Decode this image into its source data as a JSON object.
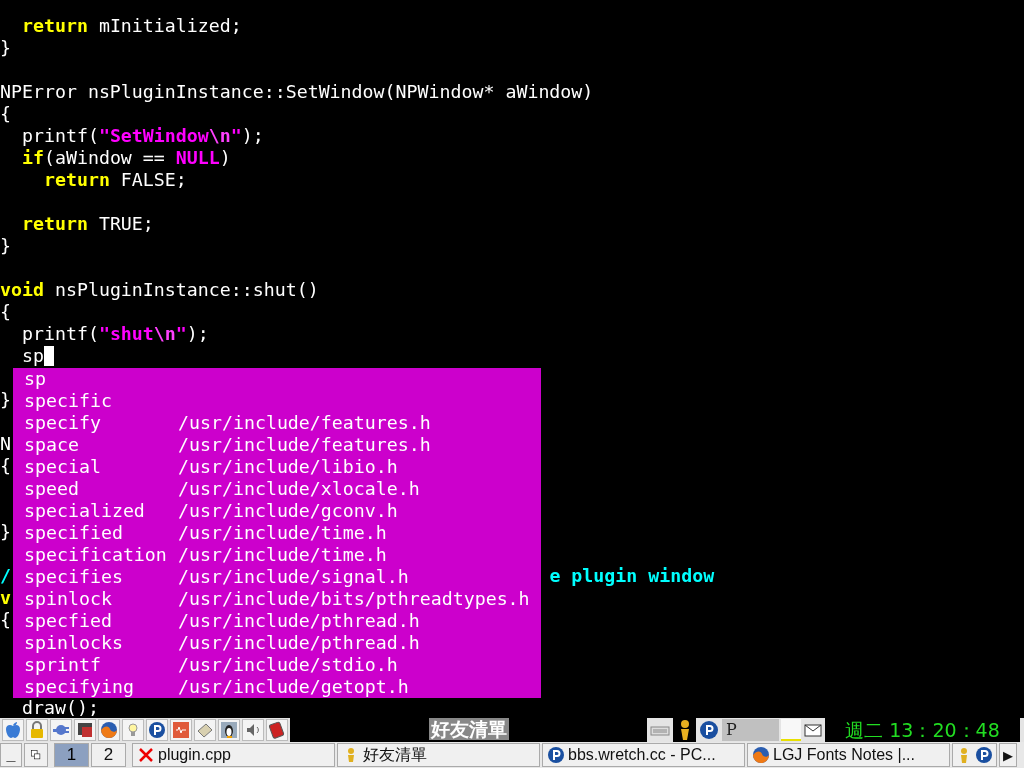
{
  "editor": {
    "lines": [
      {
        "cursor": false,
        "tokens": [
          {
            "text": "  return",
            "kind": "keyword"
          },
          {
            "text": " mInitialized;",
            "kind": "plain"
          }
        ]
      },
      {
        "cursor": false,
        "tokens": [
          {
            "text": "}",
            "kind": "plain"
          }
        ]
      },
      {
        "cursor": false
      },
      {
        "cursor": false,
        "tokens": [
          {
            "text": "NPError nsPluginInstance::SetWindow(NPWindow* aWindow)",
            "kind": "plain"
          }
        ]
      },
      {
        "cursor": false,
        "tokens": [
          {
            "text": "{",
            "kind": "plain"
          }
        ]
      },
      {
        "cursor": false,
        "tokens": [
          {
            "text": "  printf(",
            "kind": "plain"
          },
          {
            "text": "\"SetWindow",
            "kind": "string"
          },
          {
            "text": "\\n",
            "kind": "escape"
          },
          {
            "text": "\"",
            "kind": "string"
          },
          {
            "text": ");",
            "kind": "plain"
          }
        ]
      },
      {
        "cursor": false,
        "tokens": [
          {
            "text": "  if",
            "kind": "keyword"
          },
          {
            "text": "(aWindow == ",
            "kind": "plain"
          },
          {
            "text": "NULL",
            "kind": "constant"
          },
          {
            "text": ")",
            "kind": "plain"
          }
        ]
      },
      {
        "cursor": false,
        "tokens": [
          {
            "text": "    return",
            "kind": "keyword"
          },
          {
            "text": " FALSE;",
            "kind": "plain"
          }
        ]
      },
      {
        "cursor": false
      },
      {
        "cursor": false,
        "tokens": [
          {
            "text": "  return",
            "kind": "keyword"
          },
          {
            "text": " TRUE;",
            "kind": "plain"
          }
        ]
      },
      {
        "cursor": false,
        "tokens": [
          {
            "text": "}",
            "kind": "plain"
          }
        ]
      },
      {
        "cursor": false
      },
      {
        "cursor": false,
        "tokens": [
          {
            "text": "void",
            "kind": "keyword"
          },
          {
            "text": " nsPluginInstance::shut()",
            "kind": "plain"
          }
        ]
      },
      {
        "cursor": false,
        "tokens": [
          {
            "text": "{",
            "kind": "plain"
          }
        ]
      },
      {
        "cursor": false,
        "tokens": [
          {
            "text": "  printf(",
            "kind": "plain"
          },
          {
            "text": "\"shut",
            "kind": "string"
          },
          {
            "text": "\\n",
            "kind": "escape"
          },
          {
            "text": "\"",
            "kind": "string"
          },
          {
            "text": ");",
            "kind": "plain"
          }
        ]
      },
      {
        "cursor": true,
        "tokens": [
          {
            "text": "  sp",
            "kind": "plain"
          }
        ]
      },
      {
        "cursor": false
      },
      {
        "cursor": false,
        "tokens": [
          {
            "text": "}",
            "kind": "plain"
          }
        ]
      },
      {
        "cursor": false
      },
      {
        "cursor": false,
        "tokens": [
          {
            "text": "N",
            "kind": "plain"
          }
        ]
      },
      {
        "cursor": false,
        "tokens": [
          {
            "text": "{",
            "kind": "plain"
          }
        ]
      },
      {
        "cursor": false
      },
      {
        "cursor": false
      },
      {
        "cursor": false,
        "tokens": [
          {
            "text": "}",
            "kind": "plain"
          }
        ]
      },
      {
        "cursor": false
      },
      {
        "cursor": false,
        "tokens": [
          {
            "text": "/",
            "kind": "comment"
          },
          {
            "text": "                                                 e plugin window",
            "kind": "comment"
          }
        ]
      },
      {
        "cursor": false,
        "tokens": [
          {
            "text": "v",
            "kind": "keyword"
          }
        ]
      },
      {
        "cursor": false,
        "tokens": [
          {
            "text": "{",
            "kind": "plain"
          }
        ]
      },
      {
        "cursor": false
      },
      {
        "cursor": false
      },
      {
        "cursor": false
      },
      {
        "cursor": false,
        "tokens": [
          {
            "text": "  draw();",
            "kind": "plain"
          }
        ]
      }
    ]
  },
  "completion_popup": {
    "items": [
      {
        "word": "sp"
      },
      {
        "word": "specific"
      },
      {
        "word": "specify",
        "source": "/usr/include/features.h"
      },
      {
        "word": "space",
        "source": "/usr/include/features.h"
      },
      {
        "word": "special",
        "source": "/usr/include/libio.h"
      },
      {
        "word": "speed",
        "source": "/usr/include/xlocale.h"
      },
      {
        "word": "specialized",
        "source": "/usr/include/gconv.h"
      },
      {
        "word": "specified",
        "source": "/usr/include/time.h"
      },
      {
        "word": "specification",
        "source": "/usr/include/time.h"
      },
      {
        "word": "specifies",
        "source": "/usr/include/signal.h"
      },
      {
        "word": "spinlock",
        "source": "/usr/include/bits/pthreadtypes.h"
      },
      {
        "word": "specfied",
        "source": "/usr/include/pthread.h"
      },
      {
        "word": "spinlocks",
        "source": "/usr/include/pthread.h"
      },
      {
        "word": "sprintf",
        "source": "/usr/include/stdio.h"
      },
      {
        "word": "specifying",
        "source": "/usr/include/getopt.h"
      }
    ]
  },
  "taskbar": {
    "panel_label": "好友清單",
    "tray_text": "P",
    "clock": "週二 13：20：48",
    "minimize": "_",
    "desktops": [
      {
        "label": "1",
        "selected": true
      },
      {
        "label": "2",
        "selected": false
      }
    ],
    "tasks": [
      {
        "label": "plugin.cpp",
        "kind": "editor"
      },
      {
        "label": "好友清單",
        "kind": "chat"
      },
      {
        "label": "bbs.wretch.cc - PC...",
        "kind": "p-app"
      },
      {
        "label": "LGJ Fonts Notes |...",
        "kind": "browser"
      }
    ],
    "scroll_arrow": "▶"
  }
}
